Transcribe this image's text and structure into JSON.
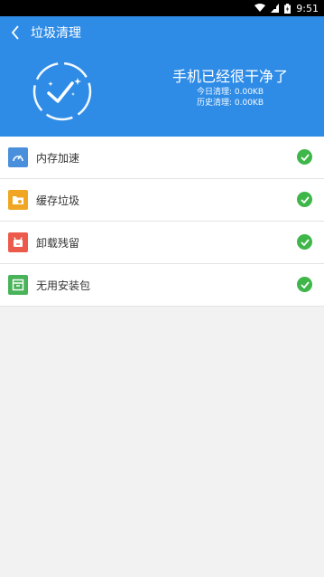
{
  "status_bar": {
    "time": "9:51"
  },
  "header": {
    "title": "垃圾清理"
  },
  "summary": {
    "message": "手机已经很干净了",
    "today": "今日清理: 0.00KB",
    "history": "历史清理: 0.00KB"
  },
  "items": [
    {
      "label": "内存加速",
      "icon": "speedometer-icon",
      "color": "#4a8fdc"
    },
    {
      "label": "缓存垃圾",
      "icon": "folder-icon",
      "color": "#f0a623"
    },
    {
      "label": "卸载残留",
      "icon": "uninstall-icon",
      "color": "#ec5a4b"
    },
    {
      "label": "无用安装包",
      "icon": "package-icon",
      "color": "#49b35a"
    }
  ],
  "colors": {
    "primary": "#2f8ce6",
    "check": "#3fb649"
  }
}
